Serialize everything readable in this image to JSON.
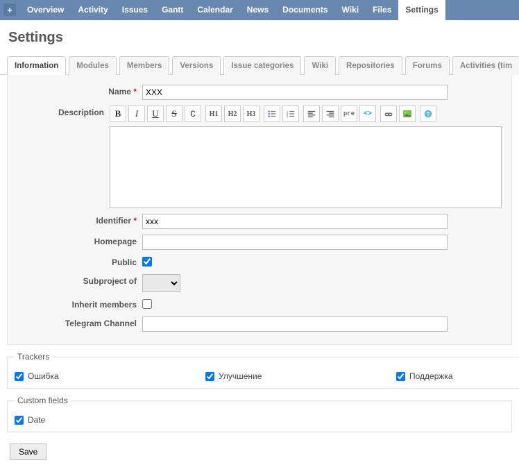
{
  "nav": {
    "items": [
      "Overview",
      "Activity",
      "Issues",
      "Gantt",
      "Calendar",
      "News",
      "Documents",
      "Wiki",
      "Files",
      "Settings"
    ],
    "active_index": 9
  },
  "page_title": "Settings",
  "tabs": {
    "items": [
      "Information",
      "Modules",
      "Members",
      "Versions",
      "Issue categories",
      "Wiki",
      "Repositories",
      "Forums",
      "Activities (tim"
    ],
    "active_index": 0
  },
  "form": {
    "name": {
      "label": "Name",
      "required": true,
      "value": "XXX"
    },
    "description": {
      "label": "Description"
    },
    "identifier": {
      "label": "Identifier",
      "required": true,
      "value": "xxx"
    },
    "homepage": {
      "label": "Homepage",
      "value": ""
    },
    "public": {
      "label": "Public",
      "checked": true
    },
    "subproject": {
      "label": "Subproject of",
      "value": ""
    },
    "inherit": {
      "label": "Inherit members",
      "checked": false
    },
    "telegram": {
      "label": "Telegram Channel",
      "value": ""
    }
  },
  "rte_toolbar": {
    "buttons": [
      "bold",
      "italic",
      "underline",
      "strike",
      "code",
      "h1",
      "h2",
      "h3",
      "ul",
      "ol",
      "align-left",
      "align-right",
      "pre",
      "html",
      "link",
      "image",
      "help"
    ]
  },
  "fieldsets": {
    "trackers": {
      "legend": "Trackers",
      "items": [
        {
          "label": "Ошибка",
          "checked": true
        },
        {
          "label": "Улучшение",
          "checked": true
        },
        {
          "label": "Поддержка",
          "checked": true
        }
      ]
    },
    "custom_fields": {
      "legend": "Custom fields",
      "items": [
        {
          "label": "Date",
          "checked": true
        }
      ]
    }
  },
  "save_label": "Save"
}
